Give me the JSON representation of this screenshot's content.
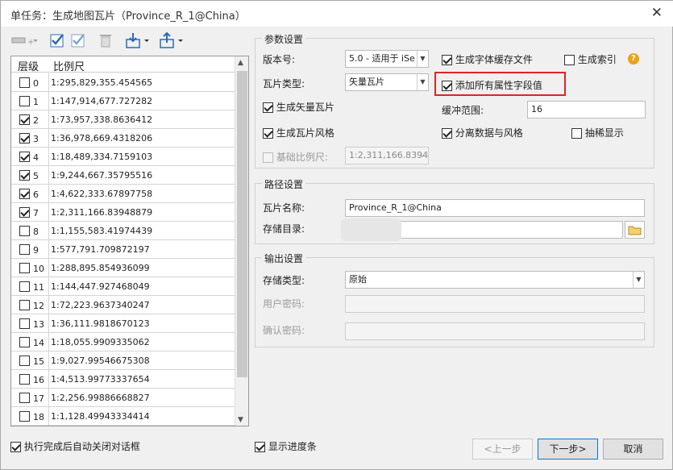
{
  "window": {
    "title": "单任务：生成地图瓦片（Province_R_1@China）",
    "close_glyph": "✕"
  },
  "levels": {
    "header_level": "层级",
    "header_scale": "比例尺",
    "rows": [
      {
        "level": "0",
        "scale": "1:295,829,355.454565",
        "checked": false
      },
      {
        "level": "1",
        "scale": "1:147,914,677.727282",
        "checked": false
      },
      {
        "level": "2",
        "scale": "1:73,957,338.8636412",
        "checked": true
      },
      {
        "level": "3",
        "scale": "1:36,978,669.4318206",
        "checked": true
      },
      {
        "level": "4",
        "scale": "1:18,489,334.7159103",
        "checked": true
      },
      {
        "level": "5",
        "scale": "1:9,244,667.35795516",
        "checked": true
      },
      {
        "level": "6",
        "scale": "1:4,622,333.67897758",
        "checked": true
      },
      {
        "level": "7",
        "scale": "1:2,311,166.83948879",
        "checked": true
      },
      {
        "level": "8",
        "scale": "1:1,155,583.41974439",
        "checked": false
      },
      {
        "level": "9",
        "scale": "1:577,791.709872197",
        "checked": false
      },
      {
        "level": "10",
        "scale": "1:288,895.854936099",
        "checked": false
      },
      {
        "level": "11",
        "scale": "1:144,447.927468049",
        "checked": false
      },
      {
        "level": "12",
        "scale": "1:72,223.9637340247",
        "checked": false
      },
      {
        "level": "13",
        "scale": "1:36,111.9818670123",
        "checked": false
      },
      {
        "level": "14",
        "scale": "1:18,055.9909335062",
        "checked": false
      },
      {
        "level": "15",
        "scale": "1:9,027.99546675308",
        "checked": false
      },
      {
        "level": "16",
        "scale": "1:4,513.99773337654",
        "checked": false
      },
      {
        "level": "17",
        "scale": "1:2,256.99886668827",
        "checked": false
      },
      {
        "level": "18",
        "scale": "1:1,128.49943334414",
        "checked": false
      }
    ]
  },
  "params": {
    "title": "参数设置",
    "version_label": "版本号:",
    "version_value": "5.0 - 适用于 iSe",
    "tile_type_label": "瓦片类型:",
    "tile_type_value": "矢量瓦片",
    "gen_vector_tiles": "生成矢量瓦片",
    "gen_tile_style": "生成瓦片风格",
    "base_scale_label": "基础比例尺:",
    "base_scale_value": "1:2,311,166.8394",
    "gen_font_cache": "生成字体缓存文件",
    "gen_index": "生成索引",
    "add_all_fields": "添加所有属性字段值",
    "buffer_label": "缓冲范围:",
    "buffer_value": "16",
    "separate_data_style": "分离数据与风格",
    "thin_display": "抽稀显示",
    "help_glyph": "?"
  },
  "path": {
    "title": "路径设置",
    "tile_name_label": "瓦片名称:",
    "tile_name_value": "Province_R_1@China",
    "dir_label": "存储目录:",
    "dir_value": ""
  },
  "output": {
    "title": "输出设置",
    "storage_type_label": "存储类型:",
    "storage_type_value": "原始",
    "user_pwd_label": "用户密码:",
    "confirm_pwd_label": "确认密码:"
  },
  "footer": {
    "auto_close": "执行完成后自动关闭对话框",
    "show_progress": "显示进度条",
    "prev": "<上一步",
    "next": "下一步>",
    "cancel": "取消"
  },
  "colors": {
    "highlight": "#e02424",
    "accent": "#0078d7",
    "help": "#e8a417"
  }
}
